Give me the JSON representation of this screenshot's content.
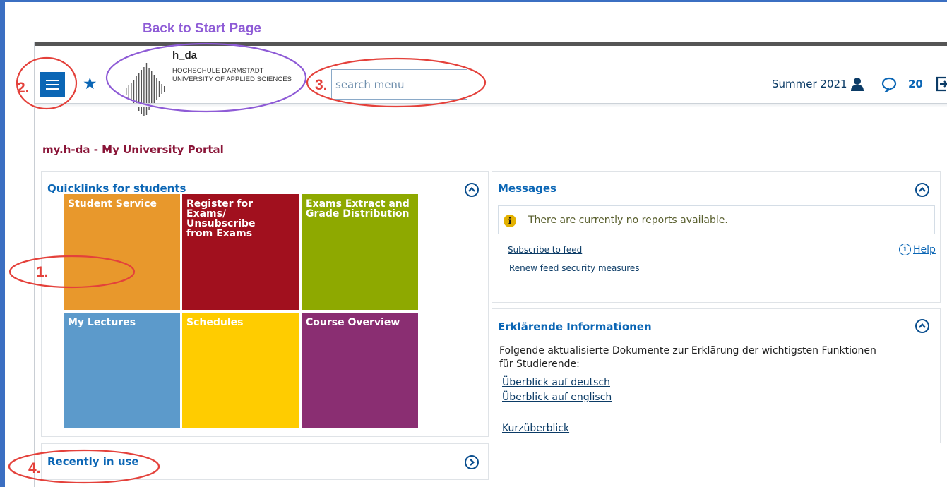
{
  "annotations": {
    "back_to_start": "Back to Start Page",
    "labels": [
      "1.",
      "2.",
      "3.",
      "4."
    ]
  },
  "header": {
    "logo": {
      "short": "h_da",
      "line1": "HOCHSCHULE DARMSTADT",
      "line2": "UNIVERSITY OF APPLIED SCIENCES"
    },
    "search_placeholder": "search menu",
    "semester": "Summer 2021",
    "message_count": "20",
    "icons": [
      "menu-icon",
      "star-icon",
      "user-icon",
      "chat-bubble-icon",
      "logout-icon"
    ]
  },
  "page_title": "my.h-da - My University Portal",
  "quicklinks": {
    "title": "Quicklinks for students",
    "tiles": [
      {
        "label": "Student Service",
        "color": "#e8982c"
      },
      {
        "label": "Register for Exams/ Unsubscribe from Exams",
        "color": "#a1101e"
      },
      {
        "label": "Exams Extract and Grade Distribution",
        "color": "#8ea900"
      },
      {
        "label": "My Lectures",
        "color": "#5c9acb"
      },
      {
        "label": "Schedules",
        "color": "#ffcc00"
      },
      {
        "label": "Course Overview",
        "color": "#8a2e72"
      }
    ]
  },
  "messages": {
    "title": "Messages",
    "empty_text": "There are currently no reports available.",
    "subscribe_link": "Subscribe to feed",
    "renew_link": "Renew feed security measures",
    "help_link": "Help"
  },
  "explanatory": {
    "title": "Erklärende Informationen",
    "text_line1": "Folgende aktualisierte Dokumente zur Erklärung der wichtigsten Funktionen",
    "text_line2": "für Studierende:",
    "links": [
      "Überblick auf deutsch",
      "Überblick auf englisch",
      "Kurzüberblick"
    ]
  },
  "recently": {
    "title": "Recently in use"
  },
  "colors": {
    "accent": "#0b66b5",
    "title": "#8a1538",
    "annotation_red": "#e4413b",
    "annotation_purple": "#8e5bd6"
  }
}
